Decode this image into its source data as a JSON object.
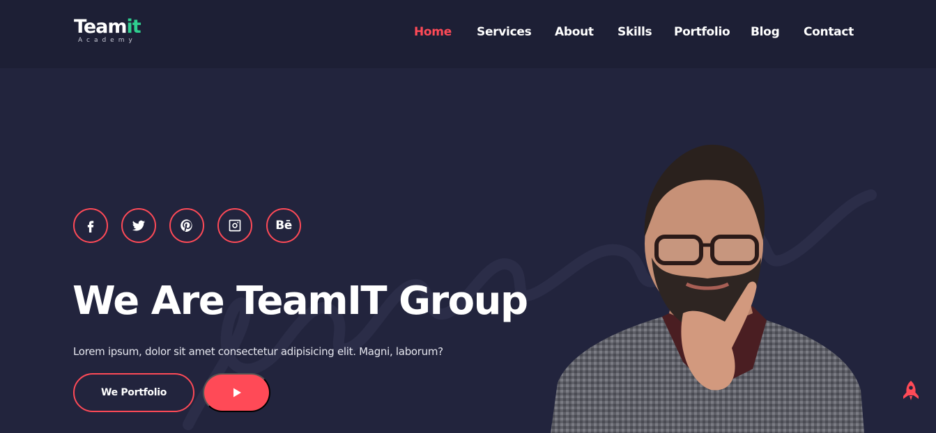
{
  "brand": {
    "logo_main": "Team",
    "logo_accent": "it",
    "logo_sub": "Academy"
  },
  "nav": {
    "items": [
      {
        "label": "Home",
        "active": true
      },
      {
        "label": "Services",
        "active": false
      },
      {
        "label": "About",
        "active": false
      },
      {
        "label": "Skills",
        "active": false
      },
      {
        "label": "Portfolio",
        "active": false
      },
      {
        "label": "Blog",
        "active": false
      },
      {
        "label": "Contact",
        "active": false
      }
    ]
  },
  "hero": {
    "socials": [
      {
        "icon": "facebook-icon"
      },
      {
        "icon": "twitter-icon"
      },
      {
        "icon": "pinterest-icon"
      },
      {
        "icon": "instagram-icon"
      },
      {
        "icon": "behance-icon",
        "label": "Bē"
      }
    ],
    "headline": "We Are TeamIT Group",
    "subtext": "Lorem ipsum, dolor sit amet consectetur adipisicing elit. Magni, laborum?",
    "portfolio_button": "We Portfolio",
    "play_button_icon": "play-icon"
  },
  "scroll_top_icon": "rocket-icon",
  "colors": {
    "accent": "#ff4a57",
    "logo_accent": "#2fcf8f",
    "background": "#22243d",
    "header": "#1d1f35"
  }
}
